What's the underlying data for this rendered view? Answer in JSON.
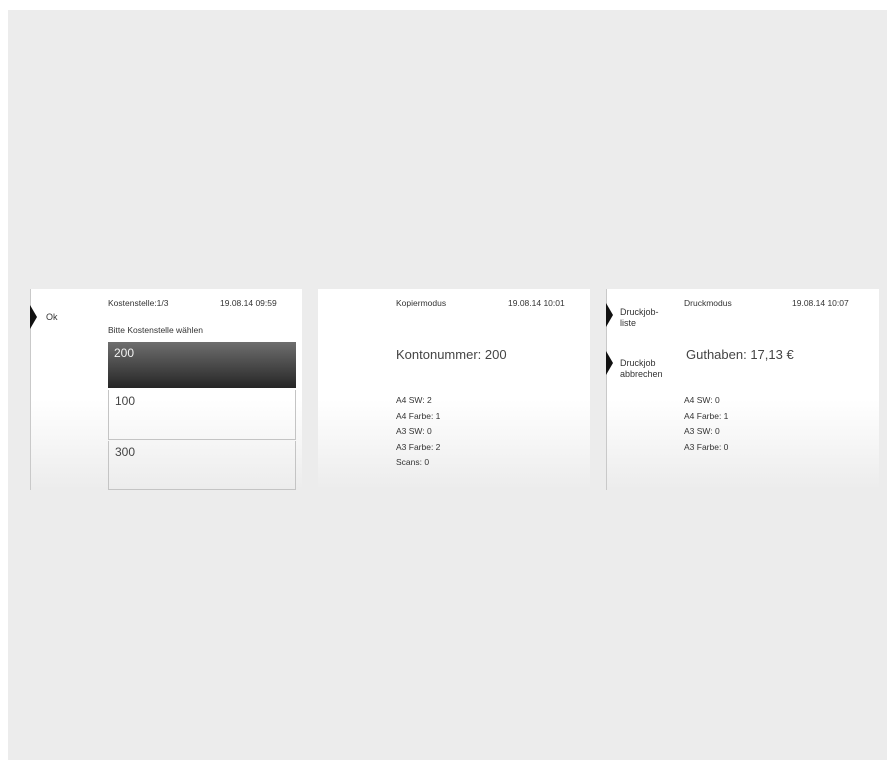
{
  "screen1": {
    "softkey_ok": "Ok",
    "header_left": "Kostenstelle:1/3",
    "header_right": "19.08.14 09:59",
    "prompt": "Bitte Kostenstelle wählen",
    "items": [
      "200",
      "100",
      "300"
    ]
  },
  "screen2": {
    "header_left": "Kopiermodus",
    "header_right": "19.08.14 10:01",
    "account": "Kontonummer: 200",
    "stats": [
      "A4 SW: 2",
      "A4 Farbe: 1",
      "A3 SW: 0",
      "A3 Farbe: 2",
      "Scans: 0"
    ]
  },
  "screen3": {
    "softkey_joblist": [
      "Druckjob-",
      "liste"
    ],
    "softkey_cancel": [
      "Druckjob",
      "abbrechen"
    ],
    "header_left": "Druckmodus",
    "header_right": "19.08.14 10:07",
    "balance": "Guthaben: 17,13 €",
    "stats": [
      "A4 SW: 0",
      "A4 Farbe: 1",
      "A3 SW: 0",
      "A3 Farbe: 0"
    ]
  }
}
